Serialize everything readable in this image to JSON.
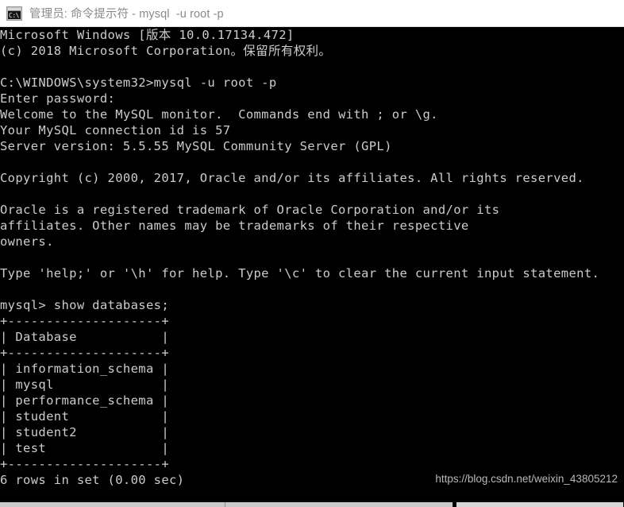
{
  "window": {
    "title": "管理员: 命令提示符 - mysql  -u root -p",
    "icon": "cmd-console-icon",
    "icon_glyph": "C:\\",
    "titlebar_bg": "#ffffff",
    "titlebar_text_color": "#8a8a8a"
  },
  "terminal": {
    "background": "#000000",
    "foreground": "#cccccc",
    "lines": [
      "Microsoft Windows [版本 10.0.17134.472]",
      "(c) 2018 Microsoft Corporation。保留所有权利。",
      "",
      "C:\\WINDOWS\\system32>mysql -u root -p",
      "Enter password:",
      "Welcome to the MySQL monitor.  Commands end with ; or \\g.",
      "Your MySQL connection id is 57",
      "Server version: 5.5.55 MySQL Community Server (GPL)",
      "",
      "Copyright (c) 2000, 2017, Oracle and/or its affiliates. All rights reserved.",
      "",
      "Oracle is a registered trademark of Oracle Corporation and/or its",
      "affiliates. Other names may be trademarks of their respective",
      "owners.",
      "",
      "Type 'help;' or '\\h' for help. Type '\\c' to clear the current input statement.",
      "",
      "mysql> show databases;",
      "+--------------------+",
      "| Database           |",
      "+--------------------+",
      "| information_schema |",
      "| mysql              |",
      "| performance_schema |",
      "| student            |",
      "| student2           |",
      "| test               |",
      "+--------------------+",
      "6 rows in set (0.00 sec)"
    ]
  },
  "command": {
    "shell_prompt": "C:\\WINDOWS\\system32>",
    "shell_command": "mysql -u root -p",
    "mysql_prompt": "mysql>",
    "mysql_command": "show databases;",
    "password_prompt": "Enter password:"
  },
  "server_info": {
    "connection_id": "57",
    "server_version": "5.5.55 MySQL Community Server (GPL)",
    "windows_version": "10.0.17134.472",
    "copyright_year": "2000, 2017",
    "microsoft_copyright_year": "2018"
  },
  "result_table": {
    "column_header": "Database",
    "rows": [
      "information_schema",
      "mysql",
      "performance_schema",
      "student",
      "student2",
      "test"
    ],
    "status": "6 rows in set (0.00 sec)",
    "row_count": "6",
    "elapsed": "0.00 sec"
  },
  "watermark": {
    "text": "https://blog.csdn.net/weixin_43805212",
    "color": "#b9b9b9"
  },
  "scrollbar": {
    "orientation": "horizontal",
    "position": "bottom"
  }
}
